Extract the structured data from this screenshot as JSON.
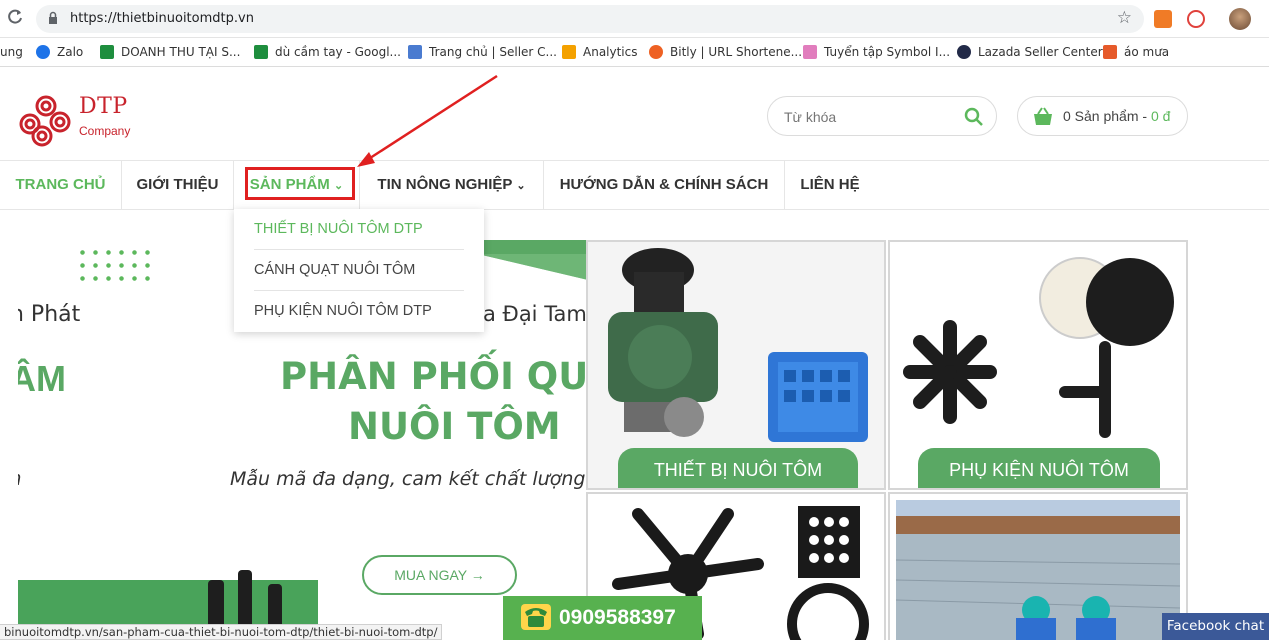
{
  "browser": {
    "url": "https://thietbinuoitomdtp.vn",
    "bookmarks": [
      {
        "label": "ung",
        "color": "#ffffff"
      },
      {
        "label": "Zalo",
        "color": "#1e73e8"
      },
      {
        "label": "DOANH THU TẠI S...",
        "color": "#1e8e3e"
      },
      {
        "label": "dù cầm tay - Googl...",
        "color": "#1e8e3e"
      },
      {
        "label": "Trang chủ | Seller C...",
        "color": "#4a7bd0"
      },
      {
        "label": "Analytics",
        "color": "#f4a100"
      },
      {
        "label": "Bitly | URL Shortene...",
        "color": "#ee6123"
      },
      {
        "label": "Tuyển tập Symbol I...",
        "color": "#e17dbd"
      },
      {
        "label": "Lazada Seller Center",
        "color": "#222a48"
      },
      {
        "label": "áo mưa",
        "color": "#e65a2a"
      }
    ]
  },
  "logo": {
    "name": "DTP",
    "sub": "Company"
  },
  "search": {
    "placeholder": "Từ khóa"
  },
  "cart": {
    "count_label": "0 Sản phẩm",
    "separator": " - ",
    "price": "0 đ"
  },
  "nav": {
    "items": [
      {
        "label": "TRANG CHỦ"
      },
      {
        "label": "GIỚI THIỆU"
      },
      {
        "label": "SẢN PHẨM"
      },
      {
        "label": "TIN NÔNG NGHIỆP"
      },
      {
        "label": "HƯỚNG DẪN & CHÍNH SÁCH"
      },
      {
        "label": "LIÊN HỆ"
      }
    ]
  },
  "dropdown": {
    "items": [
      {
        "label": "THIẾT BỊ NUÔI TÔM DTP"
      },
      {
        "label": "CÁNH QUẠT NUÔI TÔM"
      },
      {
        "label": "PHỤ KIỆN NUÔI TÔM DTP"
      }
    ]
  },
  "banner": {
    "left_fragment_1": "n Phát",
    "left_fragment_2": "ÂM",
    "left_fragment_3": "n",
    "right_fragment": "a Đại Tam",
    "headline_1": "PHÂN PHỐI QUẠT",
    "headline_2": "NUÔI TÔM",
    "tagline": "Mẫu mã đa dạng, cam kết chất lượng b",
    "cta": "MUA NGAY"
  },
  "tiles": {
    "t1_label": "THIẾT BỊ NUÔI TÔM",
    "t2_label": "PHỤ KIỆN NUÔI TÔM"
  },
  "hotline": "0909588397",
  "status_url": "binuoitomdtp.vn/san-pham-cua-thiet-bi-nuoi-tom-dtp/thiet-bi-nuoi-tom-dtp/",
  "facebook_chat": "Facebook chat",
  "colors": {
    "brand_green": "#5aa864",
    "brand_red": "#c8232c",
    "highlight": "#e02020"
  }
}
